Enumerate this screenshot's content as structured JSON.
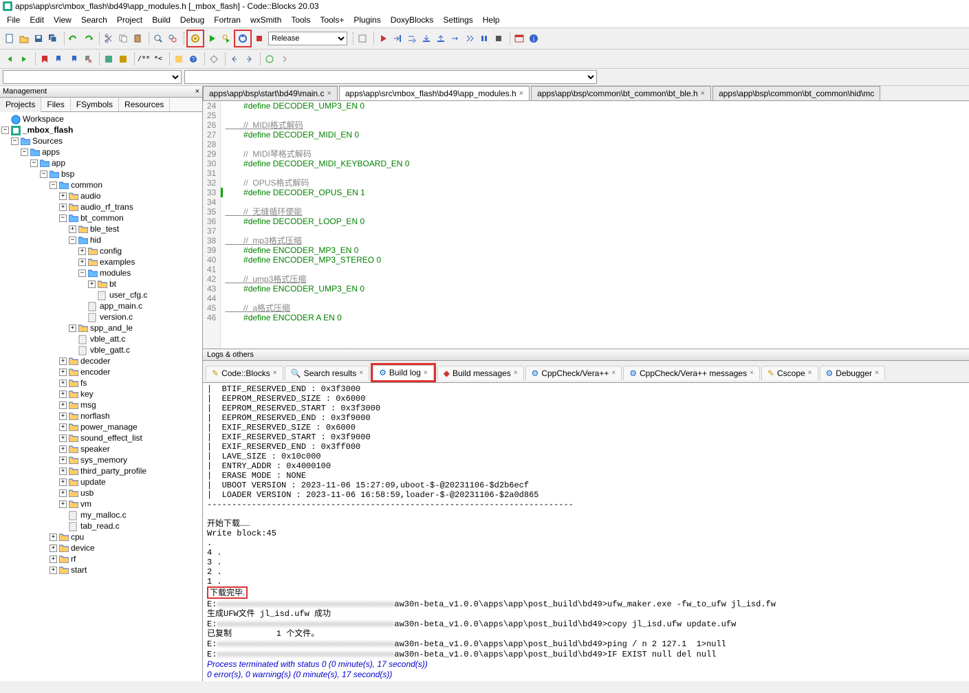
{
  "window": {
    "title": "apps\\app\\src\\mbox_flash\\bd49\\app_modules.h [_mbox_flash] - Code::Blocks 20.03"
  },
  "menu": [
    "File",
    "Edit",
    "View",
    "Search",
    "Project",
    "Build",
    "Debug",
    "Fortran",
    "wxSmith",
    "Tools",
    "Tools+",
    "Plugins",
    "DoxyBlocks",
    "Settings",
    "Help"
  ],
  "build_target": "Release",
  "management": {
    "title": "Management",
    "tabs": [
      "Projects",
      "Files",
      "FSymbols",
      "Resources"
    ],
    "active_tab": 0,
    "tree": {
      "workspace": "Workspace",
      "project": "_mbox_flash",
      "sources": "Sources",
      "apps": "apps",
      "app": "app",
      "bsp": "bsp",
      "common": "common",
      "nodes": [
        "audio",
        "audio_rf_trans",
        "bt_common"
      ],
      "bt_common_children": [
        "ble_test",
        "hid"
      ],
      "hid_children": [
        "config",
        "examples",
        "modules"
      ],
      "modules_children": [
        "bt",
        "user_cfg.c"
      ],
      "hid_files": [
        "app_main.c",
        "version.c"
      ],
      "bt_common_children2": [
        "spp_and_le"
      ],
      "bt_common_files": [
        "vble_att.c",
        "vble_gatt.c"
      ],
      "bsp_tail": [
        "decoder",
        "encoder",
        "fs",
        "key",
        "msg",
        "norflash",
        "power_manage",
        "sound_effect_list",
        "speaker",
        "sys_memory",
        "third_party_profile",
        "update",
        "usb",
        "vm"
      ],
      "bsp_files": [
        "my_malloc.c",
        "tab_read.c"
      ],
      "app_tail": [
        "cpu",
        "device",
        "rf",
        "start"
      ]
    }
  },
  "editor_tabs": [
    {
      "label": "apps\\app\\bsp\\start\\bd49\\main.c"
    },
    {
      "label": "apps\\app\\src\\mbox_flash\\bd49\\app_modules.h",
      "active": true
    },
    {
      "label": "apps\\app\\bsp\\common\\bt_common\\bt_ble.h"
    },
    {
      "label": "apps\\app\\bsp\\common\\bt_common\\hid\\mc"
    }
  ],
  "code_lines": [
    {
      "n": 24,
      "t": "#define DECODER_UMP3_EN 0",
      "c": "def"
    },
    {
      "n": 25,
      "t": "",
      "c": ""
    },
    {
      "n": 26,
      "t": "//  MIDI格式解码",
      "c": "url"
    },
    {
      "n": 27,
      "t": "#define DECODER_MIDI_EN 0",
      "c": "def"
    },
    {
      "n": 28,
      "t": "",
      "c": ""
    },
    {
      "n": 29,
      "t": "//  MIDI琴格式解码",
      "c": "cmt"
    },
    {
      "n": 30,
      "t": "#define DECODER_MIDI_KEYBOARD_EN 0",
      "c": "def"
    },
    {
      "n": 31,
      "t": "",
      "c": ""
    },
    {
      "n": 32,
      "t": "//  OPUS格式解码",
      "c": "cmt"
    },
    {
      "n": 33,
      "t": "#define DECODER_OPUS_EN 1",
      "c": "def",
      "mark": true
    },
    {
      "n": 34,
      "t": "",
      "c": ""
    },
    {
      "n": 35,
      "t": "//  无缝循环使能",
      "c": "url"
    },
    {
      "n": 36,
      "t": "#define DECODER_LOOP_EN 0",
      "c": "def"
    },
    {
      "n": 37,
      "t": "",
      "c": ""
    },
    {
      "n": 38,
      "t": "//  mp3格式压缩",
      "c": "url"
    },
    {
      "n": 39,
      "t": "#define ENCODER_MP3_EN 0",
      "c": "def"
    },
    {
      "n": 40,
      "t": "#define ENCODER_MP3_STEREO 0",
      "c": "def"
    },
    {
      "n": 41,
      "t": "",
      "c": ""
    },
    {
      "n": 42,
      "t": "//  ump3格式压缩",
      "c": "url"
    },
    {
      "n": 43,
      "t": "#define ENCODER_UMP3_EN 0",
      "c": "def"
    },
    {
      "n": 44,
      "t": "",
      "c": ""
    },
    {
      "n": 45,
      "t": "//  a格式压缩",
      "c": "url"
    },
    {
      "n": 46,
      "t": "#define ENCODER A EN 0",
      "c": "def"
    }
  ],
  "logs": {
    "title": "Logs & others",
    "tabs": [
      "Code::Blocks",
      "Search results",
      "Build log",
      "Build messages",
      "CppCheck/Vera++",
      "CppCheck/Vera++ messages",
      "Cscope",
      "Debugger"
    ],
    "active_tab": 2,
    "lines": [
      "|  BTIF_RESERVED_END : 0x3f3000",
      "|  EEPROM_RESERVED_SIZE : 0x6000",
      "|  EEPROM_RESERVED_START : 0x3f3000",
      "|  EEPROM_RESERVED_END : 0x3f9000",
      "|  EXIF_RESERVED_SIZE : 0x6000",
      "|  EXIF_RESERVED_START : 0x3f9000",
      "|  EXIF_RESERVED_END : 0x3ff000",
      "|  LAVE_SIZE : 0x10c000",
      "|  ENTRY_ADDR : 0x4000100",
      "|  ERASE MODE : NONE",
      "|  UBOOT VERSION : 2023-11-06 15:27:09,uboot-$-@20231106-$d2b6ecf",
      "|  LOADER VERSION : 2023-11-06 16:58:59,loader-$-@20231106-$2a0d865",
      "--------------------------------------------------------------------------",
      "",
      "开始下载……",
      "Write block:45",
      ".",
      "4 .",
      "3 .",
      "2 .",
      "1 ."
    ],
    "done": "下载完毕.",
    "tail": [
      {
        "pre": "E:",
        "blur": "xxxxxxxxxxxxxxxxxxxxxxxxxxxxxxxxxxxxxxxxxxx",
        "post": "aw30n-beta_v1.0.0\\apps\\app\\post_build\\bd49>ufw_maker.exe -fw_to_ufw jl_isd.fw"
      },
      {
        "pre": "生成UFW文件 jl_isd.ufw 成功",
        "blur": "",
        "post": ""
      },
      {
        "pre": "E:",
        "blur": "xxxxxxxxxxxxxxxxxxxxxxxxxxxxxxxxxxxxxxxxxxx",
        "post": "aw30n-beta_v1.0.0\\apps\\app\\post_build\\bd49>copy jl_isd.ufw update.ufw"
      },
      {
        "pre": "已复制         1 个文件。",
        "blur": "",
        "post": ""
      },
      {
        "pre": "E:",
        "blur": "xxxxxxxxxxxxxxxxxxxxxxxxxxxxxxxxxxxxxxxxxxx",
        "post": "aw30n-beta_v1.0.0\\apps\\app\\post_build\\bd49>ping / n 2 127.1  1>null"
      },
      {
        "pre": "E:",
        "blur": "xxxxxxxxxxxxxxxxxxxxxxxxxxxxxxxxxxxxxxxxxxx",
        "post": "aw30n-beta_v1.0.0\\apps\\app\\post_build\\bd49>IF EXIST null del null"
      }
    ],
    "status1": "Process terminated with status 0 (0 minute(s), 17 second(s))",
    "status2": "0 error(s), 0 warning(s) (0 minute(s), 17 second(s))"
  }
}
